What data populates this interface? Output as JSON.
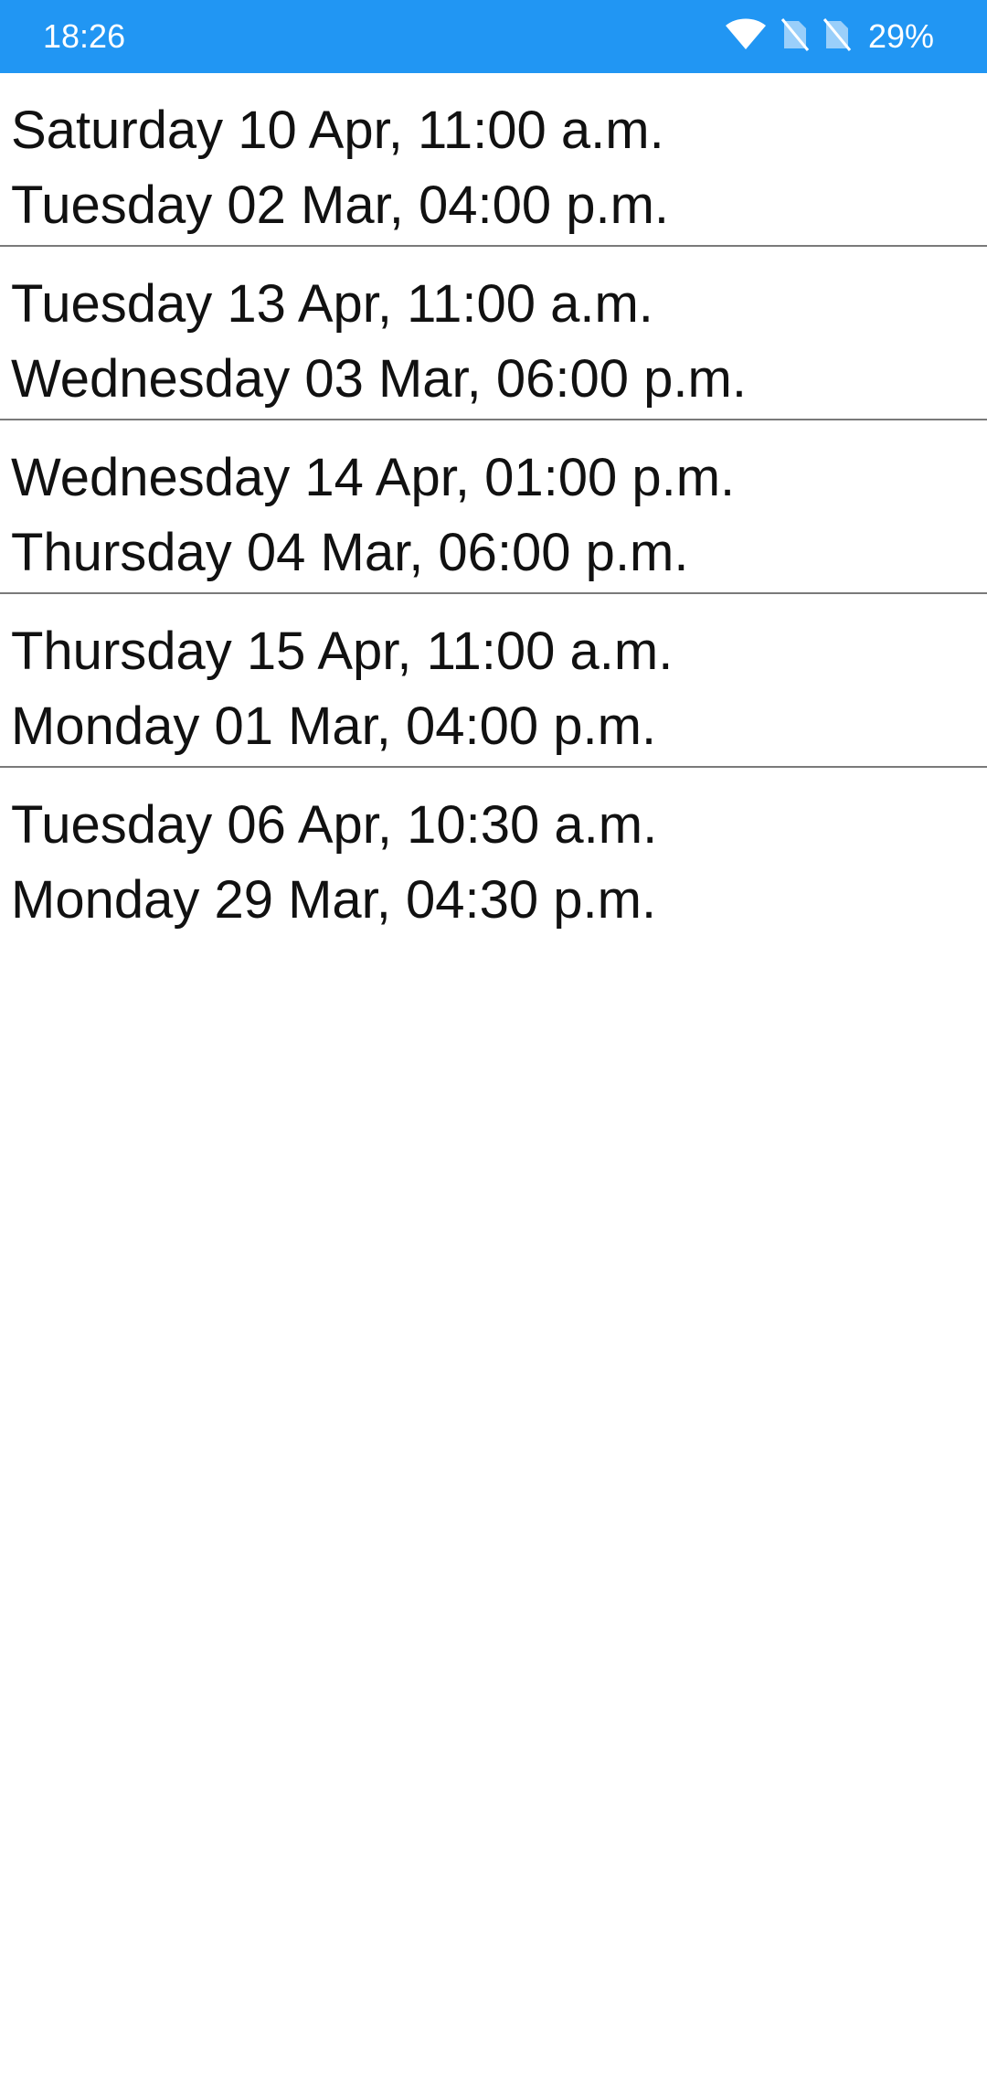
{
  "status_bar": {
    "time": "18:26",
    "battery": "29%",
    "icons": [
      "wifi-icon",
      "no-sim-icon",
      "no-sim-icon"
    ],
    "color": "#2196f3"
  },
  "items": [
    {
      "line1": "Saturday 10 Apr, 11:00 a.m.",
      "line2": "Tuesday 02 Mar, 04:00 p.m."
    },
    {
      "line1": "Tuesday 13 Apr, 11:00 a.m.",
      "line2": "Wednesday 03 Mar, 06:00 p.m."
    },
    {
      "line1": "Wednesday 14 Apr, 01:00 p.m.",
      "line2": "Thursday 04 Mar, 06:00 p.m."
    },
    {
      "line1": "Thursday 15 Apr, 11:00 a.m.",
      "line2": "Monday 01 Mar, 04:00 p.m."
    },
    {
      "line1": "Tuesday 06 Apr, 10:30 a.m.",
      "line2": "Monday 29 Mar, 04:30 p.m."
    }
  ]
}
